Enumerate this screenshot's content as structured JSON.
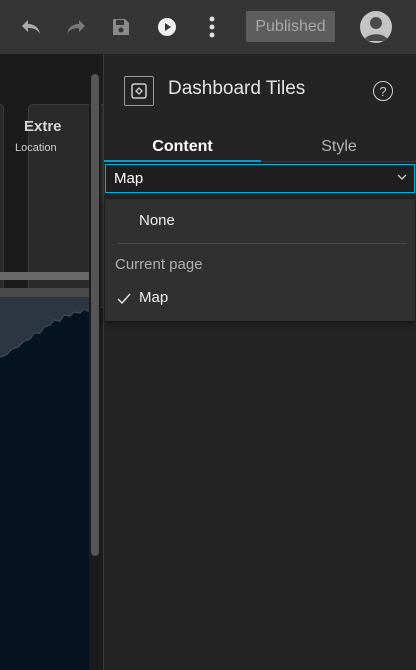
{
  "toolbar": {
    "undo_icon": "undo-icon",
    "redo_icon": "redo-icon",
    "save_icon": "save-icon",
    "preview_icon": "play-icon",
    "more_icon": "more-vertical-icon",
    "published_label": "Published",
    "avatar_icon": "user-avatar-icon"
  },
  "canvas": {
    "card_title": "Extre",
    "card_subtitle": "Location"
  },
  "panel": {
    "title": "Dashboard Tiles",
    "help_glyph": "?",
    "tabs": [
      {
        "label": "Content",
        "active": true
      },
      {
        "label": "Style",
        "active": false
      }
    ],
    "select": {
      "value": "Map",
      "chevron": "⌄"
    },
    "dropdown": {
      "none_option": "None",
      "group_label": "Current page",
      "options": [
        {
          "label": "Map",
          "selected": true
        }
      ]
    }
  },
  "colors": {
    "accent": "#00b3d6",
    "toolbar_bg": "#353535",
    "panel_bg": "#242424",
    "map_bg": "#061320"
  }
}
